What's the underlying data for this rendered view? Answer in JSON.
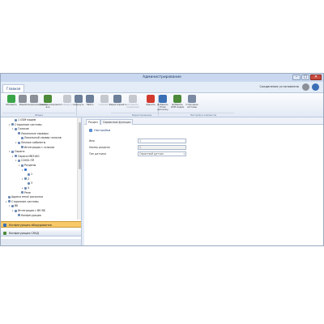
{
  "window": {
    "title": "Администрирование",
    "controls": [
      "–",
      "□",
      "✕"
    ]
  },
  "ribbon_tabs": [
    {
      "label": "Главная"
    }
  ],
  "connection_status": "Соединение установлено",
  "ribbon": {
    "buttons": [
      {
        "label": "Обновить",
        "icon": "refresh-icon",
        "color": "#3aa548",
        "enabled": true
      },
      {
        "label": "Ищем",
        "icon": "search-icon",
        "color": "#8a8f98",
        "enabled": true
      },
      {
        "label": "Синхронизировать",
        "icon": "sync-icon",
        "color": "#8a8f98",
        "enabled": true
      },
      {
        "label": "Синхронизировать все",
        "icon": "sync-all-icon",
        "color": "#4c8a3a",
        "enabled": true
      },
      {
        "label": "Развернуть",
        "icon": "expand-icon",
        "color": "#8a8f98",
        "enabled": false
      },
      {
        "label": "Свернуть",
        "icon": "collapse-icon",
        "color": "#6d7f99",
        "enabled": true
      },
      {
        "label": "Найти",
        "icon": "find-icon",
        "color": "#6d7f99",
        "enabled": true
      },
      {
        "label": "Сохранить",
        "icon": "save-icon",
        "color": "#8a8f98",
        "enabled": false
      },
      {
        "label": "Редактировать",
        "icon": "edit-icon",
        "color": "#6d7f99",
        "enabled": true
      },
      {
        "label": "Отменить изменения",
        "icon": "undo-icon",
        "color": "#8a8f98",
        "enabled": false
      },
      {
        "label": "Удалить",
        "icon": "delete-icon",
        "color": "#d23a2e",
        "enabled": true
      },
      {
        "label": "Добавить Email рассылку",
        "icon": "add-email-icon",
        "color": "#3a6fb5",
        "enabled": true
      },
      {
        "label": "Добавить GSM модем",
        "icon": "add-gsm-icon",
        "color": "#4c8a3a",
        "enabled": true
      },
      {
        "label": "Сторонние системы",
        "icon": "third-party-icon",
        "color": "#7b8aa3",
        "enabled": true
      }
    ],
    "groups": [
      {
        "label": "Общие"
      },
      {
        "label": "Редактирование"
      },
      {
        "label": "Настройка элементов"
      }
    ]
  },
  "tree": [
    {
      "label": "1 GSM модем",
      "level": 3,
      "toggle": ""
    },
    {
      "label": "Сторонние системы",
      "level": 2,
      "toggle": "▾"
    },
    {
      "label": "Голосов",
      "level": 3,
      "toggle": "▾"
    },
    {
      "label": "Локальные серверы",
      "level": 4,
      "toggle": ""
    },
    {
      "label": "Локальный сервер голосов",
      "level": 5,
      "toggle": ""
    },
    {
      "label": "Личные кабинеты",
      "level": 4,
      "toggle": "▾"
    },
    {
      "label": "Интеграция с голосов",
      "level": 5,
      "toggle": ""
    },
    {
      "label": "Охрана",
      "level": 2,
      "toggle": "▾"
    },
    {
      "label": "Охрана МВ3180",
      "level": 3,
      "toggle": "▾"
    },
    {
      "label": "С2000-ПП",
      "level": 4,
      "toggle": "▾"
    },
    {
      "label": "Разделы",
      "level": 5,
      "toggle": "▾"
    },
    {
      "label": "",
      "level": 6,
      "toggle": "▾",
      "selected": true
    },
    {
      "label": "1",
      "level": 7,
      "toggle": ""
    },
    {
      "label": "2",
      "level": 6,
      "toggle": "▾"
    },
    {
      "label": "3",
      "level": 7,
      "toggle": ""
    },
    {
      "label": "4",
      "level": 6,
      "toggle": "▸"
    },
    {
      "label": "Реле",
      "level": 5,
      "toggle": ""
    },
    {
      "label": "Адреса email рассылки",
      "level": 1,
      "toggle": ""
    },
    {
      "label": "Сторонние системы",
      "level": 1,
      "toggle": "▾"
    },
    {
      "label": "ВБ",
      "level": 2,
      "toggle": "▾"
    },
    {
      "label": "Интеграция с ВН ВБ",
      "level": 3,
      "toggle": "▾"
    },
    {
      "label": "Конфигурация",
      "level": 4,
      "toggle": ""
    }
  ],
  "nav": {
    "item1": "Конфигурация оборудования",
    "item2": "Конфигурация СКУД"
  },
  "content": {
    "tabs": [
      {
        "label": "Раздел",
        "active": true
      },
      {
        "label": "Сервисные функции",
        "active": false
      }
    ],
    "section_title": "Настройки",
    "fields": [
      {
        "label": "Имя",
        "value": "1",
        "readonly": false,
        "dropdown": false
      },
      {
        "label": "Номер раздела",
        "value": "1",
        "readonly": true,
        "dropdown": false
      },
      {
        "label": "Тип датчика",
        "value": "Охранный датчик",
        "readonly": false,
        "dropdown": true
      }
    ]
  }
}
